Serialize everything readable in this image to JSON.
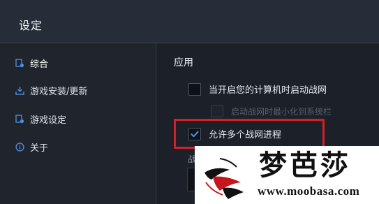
{
  "window": {
    "title": "设定"
  },
  "sidebar": {
    "items": [
      {
        "label": "综合",
        "icon": "general-settings-icon",
        "active": true
      },
      {
        "label": "游戏安装/更新",
        "icon": "download-icon",
        "active": false
      },
      {
        "label": "游戏设定",
        "icon": "game-settings-icon",
        "active": false
      },
      {
        "label": "关于",
        "icon": "info-icon",
        "active": false
      }
    ]
  },
  "main": {
    "section_title": "应用",
    "options": [
      {
        "label": "当开启您的计算机时启动战网",
        "checked": false,
        "disabled": false
      },
      {
        "label": "启动战网时最小化到系统栏",
        "checked": false,
        "disabled": true
      },
      {
        "label": "允许多个战网进程",
        "checked": true,
        "disabled": false
      }
    ],
    "partial_label": "战"
  },
  "watermark": {
    "text": "梦芭莎",
    "url": "www.moobasa.com"
  },
  "colors": {
    "highlight": "#d51f26",
    "check": "#4f8bd6",
    "titlebar": "#272d38",
    "background": "#1b2029"
  }
}
